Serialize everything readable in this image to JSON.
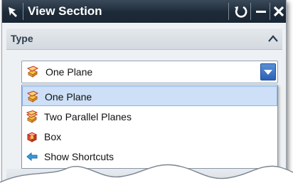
{
  "window": {
    "title": "View Section"
  },
  "section": {
    "title": "Type"
  },
  "type_select": {
    "selected": "One Plane"
  },
  "dropdown": {
    "items": [
      {
        "label": "One Plane",
        "icon": "one-plane-icon",
        "selected": true
      },
      {
        "label": "Two Parallel Planes",
        "icon": "two-parallel-planes-icon",
        "selected": false
      },
      {
        "label": "Box",
        "icon": "box-icon",
        "selected": false
      },
      {
        "label": "Show Shortcuts",
        "icon": "show-shortcuts-icon",
        "selected": false
      }
    ]
  },
  "colors": {
    "titlebar": "#1d2a38",
    "selection": "#cde0f7",
    "accent": "#2a62b8"
  }
}
